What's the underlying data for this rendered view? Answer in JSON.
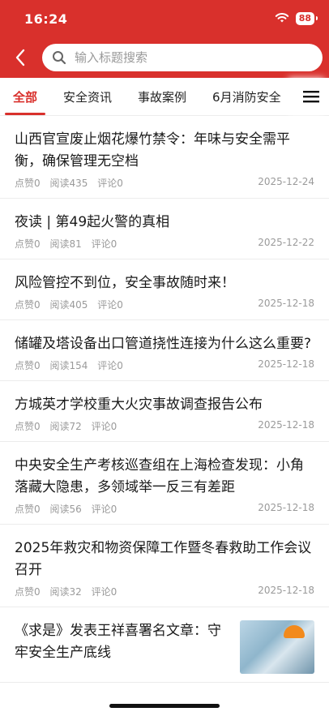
{
  "status_bar": {
    "time": "16:24",
    "battery": "88"
  },
  "search": {
    "placeholder": "输入标题搜索"
  },
  "tabs": [
    {
      "label": "全部",
      "active": true
    },
    {
      "label": "安全资讯",
      "active": false
    },
    {
      "label": "事故案例",
      "active": false
    },
    {
      "label": "6月消防安全",
      "active": false
    }
  ],
  "colors": {
    "brand": "#d9302c",
    "meta": "#9a9a9a"
  },
  "articles": [
    {
      "title": "山西官宣废止烟花爆竹禁令：年味与安全需平衡，确保管理无空档",
      "likes": "点赞0",
      "reads": "阅读435",
      "comments": "评论0",
      "date": "2025-12-24"
    },
    {
      "title": "夜读 | 第49起火警的真相",
      "likes": "点赞0",
      "reads": "阅读81",
      "comments": "评论0",
      "date": "2025-12-22"
    },
    {
      "title": "风险管控不到位，安全事故随时来！",
      "likes": "点赞0",
      "reads": "阅读405",
      "comments": "评论0",
      "date": "2025-12-18"
    },
    {
      "title": "储罐及塔设备出口管道挠性连接为什么这么重要?",
      "likes": "点赞0",
      "reads": "阅读154",
      "comments": "评论0",
      "date": "2025-12-18"
    },
    {
      "title": "方城英才学校重大火灾事故调查报告公布",
      "likes": "点赞0",
      "reads": "阅读72",
      "comments": "评论0",
      "date": "2025-12-18"
    },
    {
      "title": "中央安全生产考核巡查组在上海检查发现：小角落藏大隐患，多领域举一反三有差距",
      "likes": "点赞0",
      "reads": "阅读56",
      "comments": "评论0",
      "date": "2025-12-18"
    },
    {
      "title": "2025年救灾和物资保障工作暨冬春救助工作会议召开",
      "likes": "点赞0",
      "reads": "阅读32",
      "comments": "评论0",
      "date": "2025-12-18"
    },
    {
      "title": "《求是》发表王祥喜署名文章：守牢安全生产底线",
      "thumbnail": "hard-hat-worker-photo"
    }
  ]
}
